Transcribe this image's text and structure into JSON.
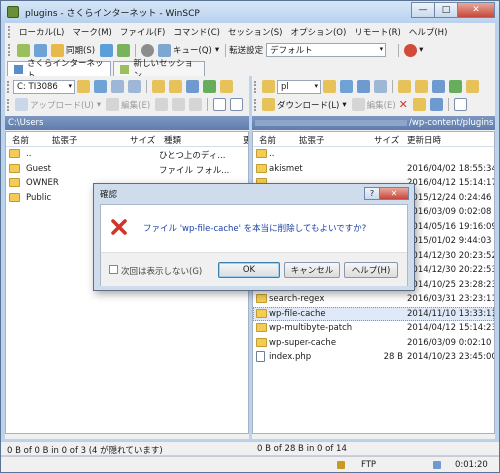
{
  "window": {
    "title": "plugins - さくらインターネット - WinSCP",
    "buttons": [
      "—",
      "□",
      "✕"
    ]
  },
  "menu": [
    "ローカル(L)",
    "マーク(M)",
    "ファイル(F)",
    "コマンド(C)",
    "セッション(S)",
    "オプション(O)",
    "リモート(R)",
    "ヘルプ(H)"
  ],
  "toolbar": {
    "sync_label": "同期(S)",
    "queue_label": "キュー(Q)",
    "transfer_settings_label": "転送設定",
    "transfer_settings_value": "デフォルト"
  },
  "tabs": [
    {
      "label": "さくらインターネット",
      "active": true
    },
    {
      "label": "新しいセッション",
      "active": false
    }
  ],
  "left_panel": {
    "drive": "C: TI3086",
    "upload_label": "アップロード(U)",
    "edit_label": "編集(E)",
    "path": "C:\\Users",
    "columns": [
      "名前",
      "拡張子",
      "サイズ",
      "種類",
      "更"
    ],
    "rows": [
      {
        "name": "..",
        "size": "",
        "type": "ひとつ上のディ..."
      },
      {
        "name": "Guest",
        "size": "",
        "type": "ファイル フォル..."
      },
      {
        "name": "OWNER",
        "size": "",
        "type": ""
      },
      {
        "name": "Public",
        "size": "",
        "type": ""
      }
    ],
    "status": "0 B of 0 B in 0 of 3 (4 が隠れています)"
  },
  "right_panel": {
    "dir": "pl",
    "download_label": "ダウンロード(L)",
    "edit_label": "編集(E)",
    "path": "/wp-content/plugins",
    "columns": [
      "名前",
      "拡張子",
      "サイズ",
      "更新日時"
    ],
    "rows": [
      {
        "name": "..",
        "size": "",
        "date": ""
      },
      {
        "name": "akismet",
        "size": "",
        "date": "2016/04/02 18:55:34"
      },
      {
        "name": "",
        "size": "",
        "date": "2016/04/12 15:14:17"
      },
      {
        "name": "",
        "size": "",
        "date": "2015/12/24 0:24:46"
      },
      {
        "name": "",
        "size": "",
        "date": "2016/03/09 0:02:08"
      },
      {
        "name": "",
        "size": "",
        "date": "2014/05/16 19:16:09"
      },
      {
        "name": "",
        "size": "",
        "date": "2015/01/02 9:44:03"
      },
      {
        "name": "",
        "size": "",
        "date": "2014/12/30 20:23:52"
      },
      {
        "name": "",
        "size": "",
        "date": "2014/12/30 20:22:53"
      },
      {
        "name": "movabletype-impo...",
        "size": "",
        "date": "2014/10/25 23:28:23"
      },
      {
        "name": "search-regex",
        "size": "",
        "date": "2016/03/31 23:23:11"
      },
      {
        "name": "wp-file-cache",
        "size": "",
        "date": "2014/11/10 13:33:11"
      },
      {
        "name": "wp-multibyte-patch",
        "size": "",
        "date": "2014/04/12 15:14:23"
      },
      {
        "name": "wp-super-cache",
        "size": "",
        "date": "2016/03/09 0:02:10"
      },
      {
        "name": "index.php",
        "size": "28 B",
        "date": "2014/10/23 23:45:00",
        "file": true
      }
    ],
    "status": "0 B of 28 B in 0 of 14"
  },
  "bottom": {
    "protocol": "FTP",
    "elapsed": "0:01:20"
  },
  "dialog": {
    "title": "確認",
    "buttons": [
      "?",
      "✕"
    ],
    "message": "ファイル 'wp-file-cache' を本当に削除してもよいですか?",
    "checkbox_label": "次回は表示しない(G)",
    "ok_label": "OK",
    "cancel_label": "キャンセル",
    "help_label": "ヘルプ(H)"
  },
  "colors": {
    "title_bg": "#bcd3ec",
    "path_bg": "#6a88b8",
    "message": "#1b3fa6",
    "error_icon": "#d0352a"
  }
}
